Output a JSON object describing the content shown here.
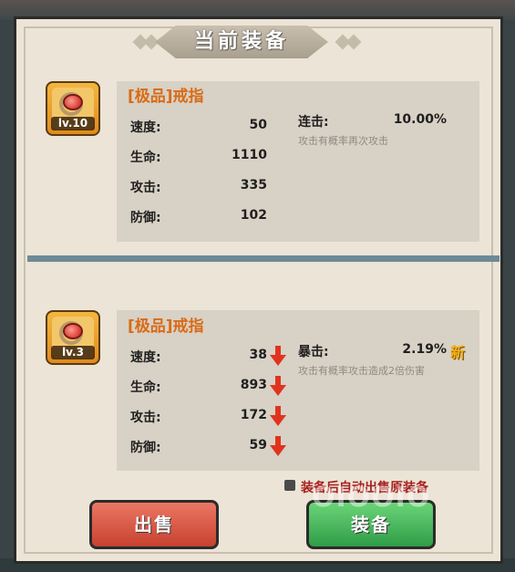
{
  "header": {
    "title": "当前装备"
  },
  "current_item": {
    "level": "lv.10",
    "name": "[极品]戒指",
    "stats": [
      {
        "label": "速度:",
        "value": "50"
      },
      {
        "label": "生命:",
        "value": "1110"
      },
      {
        "label": "攻击:",
        "value": "335"
      },
      {
        "label": "防御:",
        "value": "102"
      }
    ],
    "special": {
      "label": "连击:",
      "value": "10.00%",
      "desc": "攻击有概率再次攻击"
    }
  },
  "new_item": {
    "level": "lv.3",
    "name": "[极品]戒指",
    "stats": [
      {
        "label": "速度:",
        "value": "38",
        "trend": "down"
      },
      {
        "label": "生命:",
        "value": "893",
        "trend": "down"
      },
      {
        "label": "攻击:",
        "value": "172",
        "trend": "down"
      },
      {
        "label": "防御:",
        "value": "59",
        "trend": "down"
      }
    ],
    "special": {
      "label": "暴击:",
      "value": "2.19%",
      "desc": "攻击有概率攻击造成2倍伤害",
      "badge": "新"
    }
  },
  "options": {
    "auto_sell_label": "装备后自动出售原装备"
  },
  "buttons": {
    "sell": "出售",
    "equip": "装备"
  },
  "watermark": "OIOOIO",
  "colors": {
    "name_orange": "#d86b16",
    "down_red": "#e0331f",
    "sell_red": "#d9513d",
    "equip_green": "#3fb354"
  }
}
